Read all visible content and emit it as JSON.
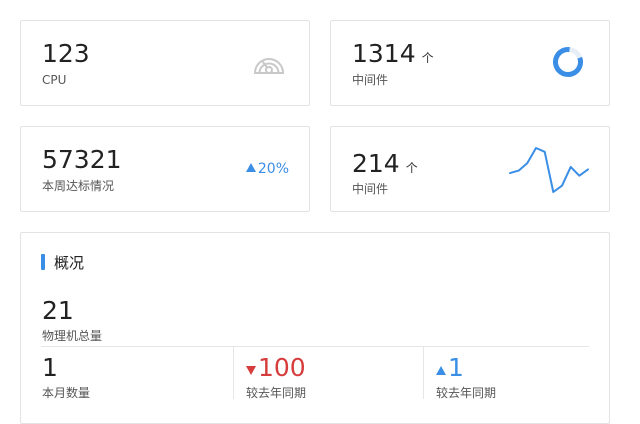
{
  "colors": {
    "accent": "#3a8ee6",
    "down": "#d63c3c",
    "icon_gray": "#c8c8c8",
    "border": "#e3e3e3"
  },
  "cards": {
    "cpu": {
      "value": "123",
      "label": "CPU",
      "icon": "gauge-icon"
    },
    "middleware_total": {
      "value": "1314",
      "unit": "个",
      "label": "中间件",
      "icon": "donut-progress-icon",
      "progress": 0.82
    },
    "weekly_target": {
      "value": "57321",
      "label": "本周达标情况",
      "trend": "20%",
      "trend_direction": "up"
    },
    "middleware_trend": {
      "value": "214",
      "unit": "个",
      "label": "中间件",
      "sparkline": [
        20,
        22,
        28,
        40,
        37,
        5,
        10,
        25,
        18,
        23
      ]
    }
  },
  "overview": {
    "title": "概况",
    "total": {
      "value": "21",
      "label": "物理机总量"
    },
    "monthly": {
      "value": "1",
      "label": "本月数量"
    },
    "yoy_a": {
      "value": "100",
      "label": "较去年同期",
      "direction": "down"
    },
    "yoy_b": {
      "value": "1",
      "label": "较去年同期",
      "direction": "up"
    }
  }
}
